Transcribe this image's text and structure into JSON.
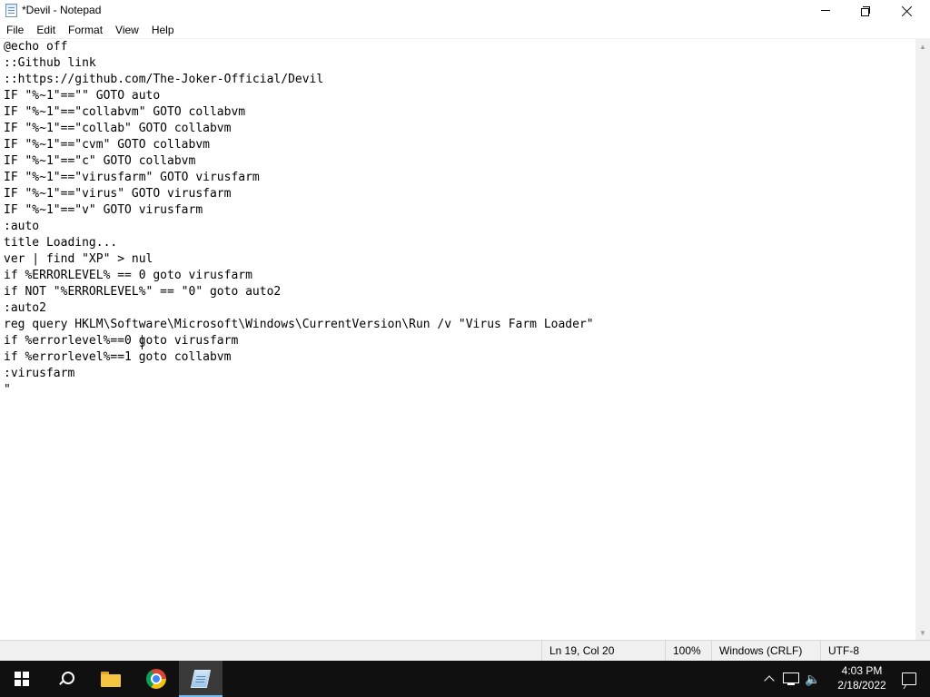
{
  "window": {
    "title": "*Devil - Notepad"
  },
  "menu": {
    "items": [
      "File",
      "Edit",
      "Format",
      "View",
      "Help"
    ]
  },
  "editor": {
    "content": "@echo off\n::Github link\n::https://github.com/The-Joker-Official/Devil\nIF \"%~1\"==\"\" GOTO auto\nIF \"%~1\"==\"collabvm\" GOTO collabvm\nIF \"%~1\"==\"collab\" GOTO collabvm\nIF \"%~1\"==\"cvm\" GOTO collabvm\nIF \"%~1\"==\"c\" GOTO collabvm\nIF \"%~1\"==\"virusfarm\" GOTO virusfarm\nIF \"%~1\"==\"virus\" GOTO virusfarm\nIF \"%~1\"==\"v\" GOTO virusfarm\n:auto\ntitle Loading...\nver | find \"XP\" > nul\nif %ERRORLEVEL% == 0 goto virusfarm\nif NOT \"%ERRORLEVEL%\" == \"0\" goto auto2\n:auto2\nreg query HKLM\\Software\\Microsoft\\Windows\\CurrentVersion\\Run /v \"Virus Farm Loader\"\nif %errorlevel%==0 goto virusfarm\nif %errorlevel%==1 goto collabvm\n:virusfarm\n\""
  },
  "statusbar": {
    "position": "Ln 19, Col 20",
    "zoom": "100%",
    "line_ending": "Windows (CRLF)",
    "encoding": "UTF-8"
  },
  "taskbar": {
    "clock_time": "4:03 PM",
    "clock_date": "2/18/2022",
    "icons": [
      "windows-start-icon",
      "search-icon",
      "file-explorer-icon",
      "chrome-icon",
      "notepad-icon"
    ],
    "tray_icons": [
      "chevron-up-icon",
      "network-icon",
      "volume-icon",
      "notifications-icon"
    ],
    "accent_color": "#76b9ed"
  }
}
